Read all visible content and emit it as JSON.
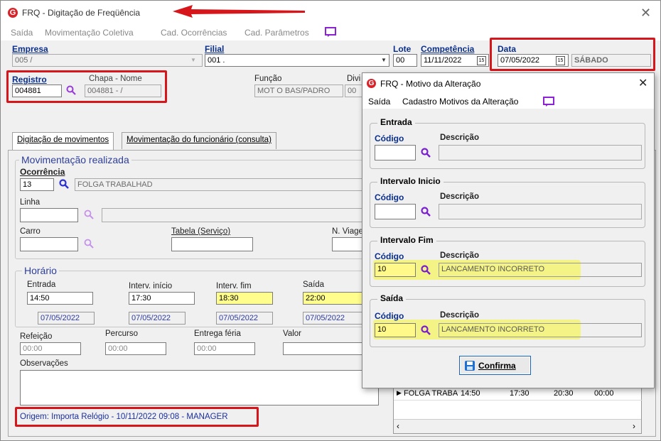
{
  "window": {
    "title": "FRQ - Digitação de Freqüência"
  },
  "menu": [
    "Saída",
    "Movimentação Coletiva",
    "Cad. Ocorrências",
    "Cad. Parâmetros"
  ],
  "header": {
    "empresa_label": "Empresa",
    "empresa_value": "005 /",
    "filial_label": "Filial",
    "filial_value": "001 .",
    "lote_label": "Lote",
    "lote_value": "00",
    "competencia_label": "Competência",
    "competencia_value": "11/11/2022",
    "data_label": "Data",
    "data_value": "07/05/2022",
    "weekday": "SÁBADO",
    "registro_label": "Registro",
    "registro_value": "004881",
    "chapa_label": "Chapa  -  Nome",
    "chapa_value": "004881 - /",
    "funcao_label": "Função",
    "funcao_value": "MOT O BAS/PADRO",
    "divisao_label": "Divi",
    "divisao_value": "00"
  },
  "tabs": [
    "Digitação de movimentos",
    "Movimentação do funcionário (consulta)"
  ],
  "movimentacao": {
    "group_title": "Movimentação realizada",
    "ocorrencia_label": "Ocorrência",
    "ocorrencia_code": "13",
    "ocorrencia_desc": "FOLGA TRABALHAD",
    "linha_label": "Linha",
    "carro_label": "Carro",
    "tabela_label": "Tabela (Serviço)",
    "nviagem_label": "N. Viage"
  },
  "horario": {
    "group_title": "Horário",
    "entrada_label": "Entrada",
    "entrada": "14:50",
    "entrada_data": "07/05/2022",
    "inicio_label": "Interv. início",
    "inicio": "17:30",
    "inicio_data": "07/05/2022",
    "fim_label": "Interv. fim",
    "fim": "18:30",
    "fim_data": "07/05/2022",
    "saida_label": "Saída",
    "saida": "22:00",
    "saida_data": "07/05/2022"
  },
  "extras": {
    "refeicao_label": "Refeição",
    "refeicao": "00:00",
    "percurso_label": "Percurso",
    "percurso": "00:00",
    "entrega_label": "Entrega féria",
    "entrega": "00:00",
    "valor_label": "Valor",
    "obs_label": "Observações",
    "origem": "Origem: Importa Relógio - 10/11/2022 09:08 - MANAGER"
  },
  "grid_row": {
    "col1": "FOLGA TRABA",
    "col2": "14:50",
    "col3": "17:30",
    "col4": "20:30",
    "col5": "00:00"
  },
  "dialog": {
    "title": "FRQ - Motivo da Alteração",
    "menu": [
      "Saída",
      "Cadastro Motivos da Alteração"
    ],
    "groups": [
      {
        "title": "Entrada",
        "codigo_label": "Código",
        "desc_label": "Descrição",
        "codigo": "",
        "desc": ""
      },
      {
        "title": "Intervalo Inicio",
        "codigo_label": "Código",
        "desc_label": "Descrição",
        "codigo": "",
        "desc": ""
      },
      {
        "title": "Intervalo Fim",
        "codigo_label": "Código",
        "desc_label": "Descrição",
        "codigo": "10",
        "desc": "LANCAMENTO INCORRETO"
      },
      {
        "title": "Saída",
        "codigo_label": "Código",
        "desc_label": "Descrição",
        "codigo": "10",
        "desc": "LANCAMENTO INCORRETO"
      }
    ],
    "confirm_label": "Confirma"
  },
  "colors": {
    "annotation_red": "#d6161b",
    "highlight_yellow": "#f4f37a",
    "label_blue": "#0a2f8a",
    "logo_red": "#d8232a"
  }
}
